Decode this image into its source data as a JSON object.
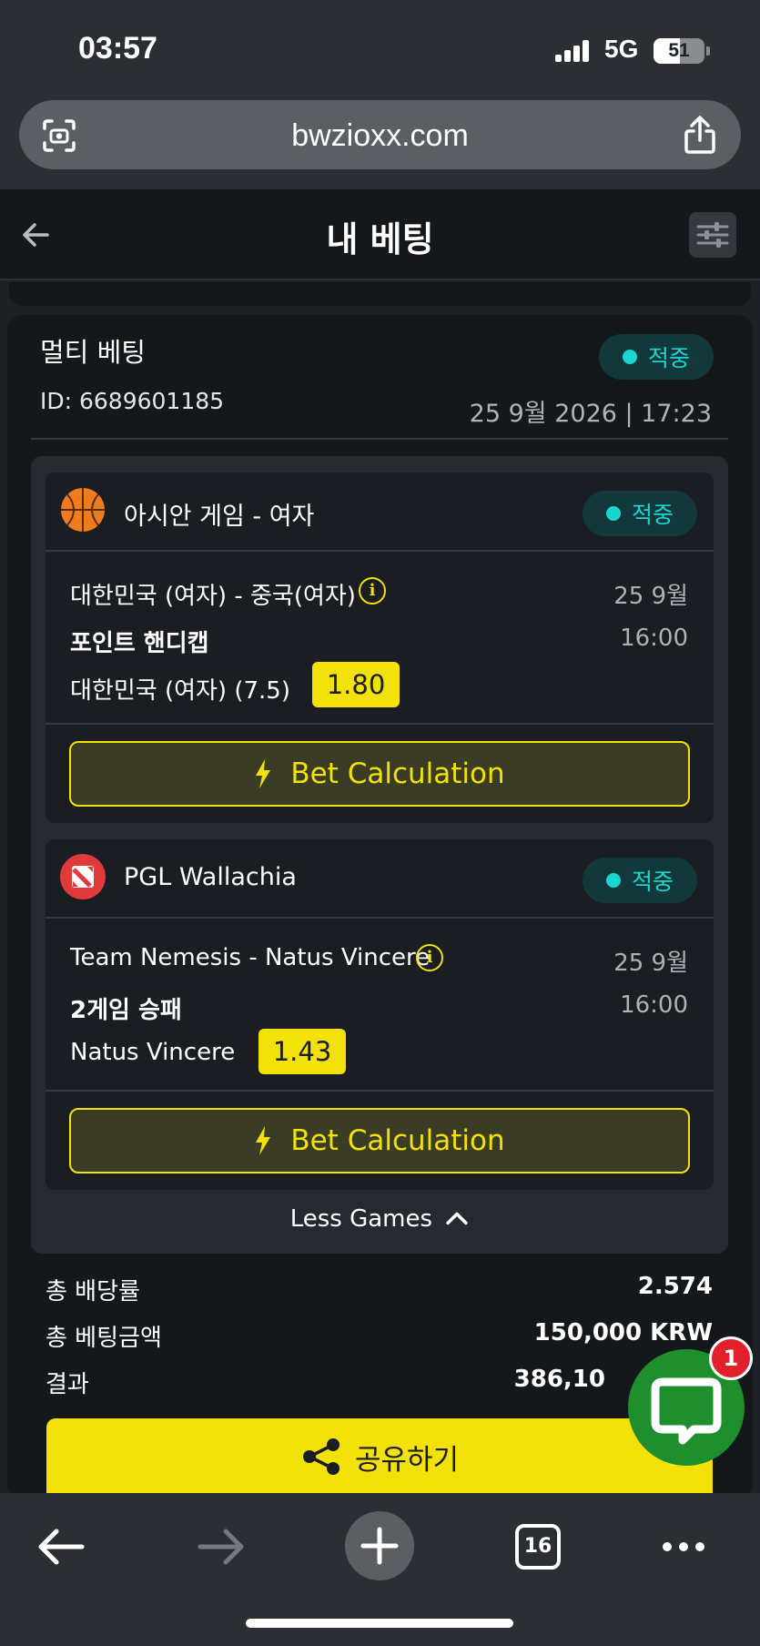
{
  "status_bar": {
    "time": "03:57",
    "network": "5G",
    "battery": "51",
    "battery_level": 0.51
  },
  "browser": {
    "url": "bwzioxx.com",
    "open_tabs": "16"
  },
  "header": {
    "title": "내 베팅"
  },
  "bet": {
    "type_label": "멀티 베팅",
    "id_label": "ID: 6689601185",
    "status": "적중",
    "datetime": "25 9월 2026 | 17:23"
  },
  "games": [
    {
      "league": "아시안 게임 - 여자",
      "sport_icon": "basketball-icon",
      "status": "적중",
      "match": "대한민국 (여자) - 중국(여자)",
      "date": "25 9월",
      "market": "포인트 핸디캡",
      "time": "16:00",
      "pick": "대한민국 (여자) (7.5)",
      "odds": "1.80",
      "calc_label": "Bet Calculation"
    },
    {
      "league": "PGL Wallachia",
      "sport_icon": "dota-icon",
      "status": "적중",
      "match": "Team Nemesis - Natus Vincere",
      "date": "25 9월",
      "market": "2게임 승패",
      "time": "16:00",
      "pick": "Natus Vincere",
      "odds": "1.43",
      "calc_label": "Bet Calculation"
    }
  ],
  "less_games_label": "Less Games",
  "summary": [
    {
      "label": "총 배당률",
      "value": "2.574"
    },
    {
      "label": "총 베팅금액",
      "value": "150,000 KRW"
    },
    {
      "label": "결과",
      "value": "386,10"
    }
  ],
  "share_label": "공유하기",
  "chat": {
    "badge": "1"
  },
  "colors": {
    "accent": "#f2e20a",
    "win": "#19d6d0",
    "chat": "#1f8f2e",
    "badge": "#e0212b"
  }
}
